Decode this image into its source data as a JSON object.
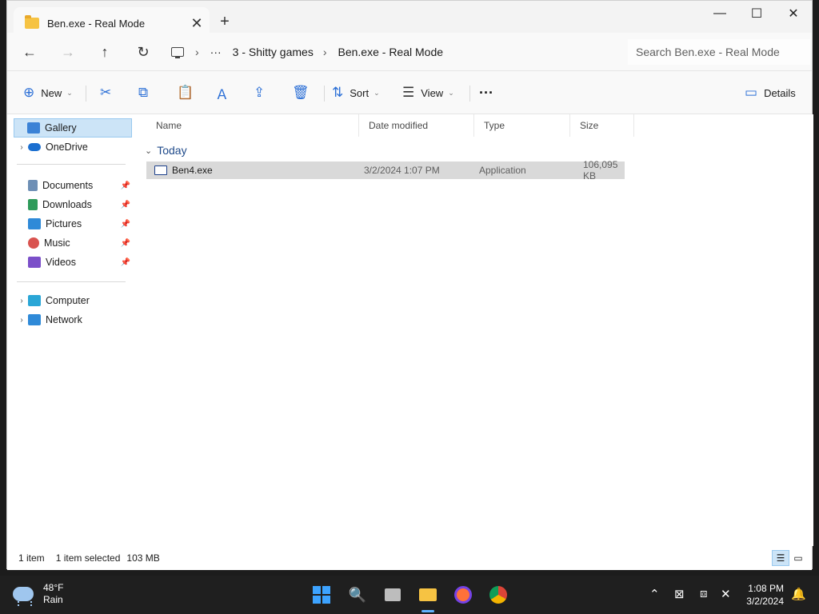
{
  "window": {
    "tab_title": "Ben.exe - Real Mode",
    "tab_close": "✕",
    "new_tab": "+",
    "minimize": "—",
    "maximize": "☐",
    "close": "✕"
  },
  "address": {
    "back": "←",
    "forward": "→",
    "up": "↑",
    "refresh": "↻",
    "more": "···",
    "crumbs": [
      "3 - Shitty games",
      "Ben.exe - Real Mode"
    ],
    "separator": "›",
    "search_placeholder": "Search Ben.exe - Real Mode"
  },
  "commands": {
    "new_label": "New",
    "sort_label": "Sort",
    "view_label": "View",
    "more": "···",
    "details_label": "Details",
    "chevron": "⌄",
    "icons": {
      "new": "⊕",
      "cut": "✂",
      "copy": "⧉",
      "paste": "📋",
      "rename": "Ａ",
      "share": "⇪",
      "delete": "🗑",
      "sort": "⇅",
      "view": "☰",
      "details": "▭"
    }
  },
  "sidebar": {
    "expand": "›",
    "pin": "📌",
    "items": [
      {
        "label": "Gallery",
        "color": "#3b82d6"
      },
      {
        "label": "OneDrive",
        "color": "#1b6fd0"
      },
      {
        "label": "Documents",
        "color": "#6e8fb5"
      },
      {
        "label": "Downloads",
        "color": "#2e9b5a"
      },
      {
        "label": "Pictures",
        "color": "#2f8ad8"
      },
      {
        "label": "Music",
        "color": "#d9534f"
      },
      {
        "label": "Videos",
        "color": "#7b4fc9"
      },
      {
        "label": "Computer",
        "color": "#2aa6d6"
      },
      {
        "label": "Network",
        "color": "#2f8ad8"
      }
    ]
  },
  "content": {
    "columns": [
      "Name",
      "Date modified",
      "Type",
      "Size"
    ],
    "group": "Today",
    "group_chevron": "⌄",
    "rows": [
      {
        "name": "Ben4.exe",
        "date": "3/2/2024 1:07 PM",
        "type": "Application",
        "size": "106,095 KB"
      }
    ]
  },
  "status": {
    "count": "1 item",
    "selected": "1 item selected",
    "size": "103 MB",
    "details_view": "☰",
    "tiles_view": "▭"
  },
  "taskbar": {
    "temp": "48°F",
    "condition": "Rain",
    "search": "🔍",
    "chevron_up": "⌃",
    "time": "1:08 PM",
    "date": "3/2/2024",
    "bell": "🔔",
    "network": "⊠",
    "display": "⧈",
    "volume": "✕"
  },
  "colors": {
    "accent": "#2b6fd6",
    "selection": "#cce4f7"
  }
}
